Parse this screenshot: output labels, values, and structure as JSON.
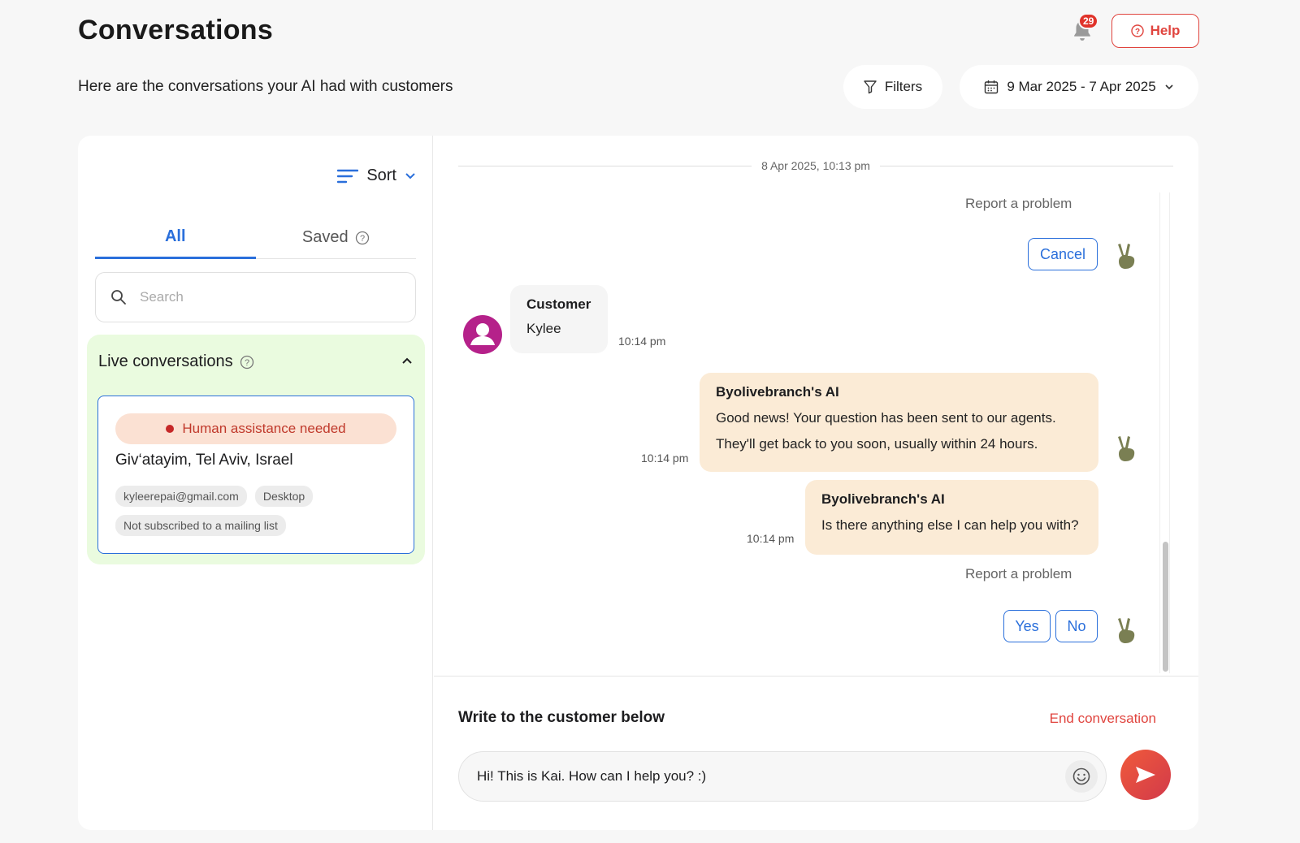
{
  "header": {
    "title": "Conversations",
    "subtitle": "Here are the conversations your AI had with customers",
    "notification_count": "29",
    "help_label": "Help",
    "filters_label": "Filters",
    "date_range": "9 Mar 2025 - 7 Apr 2025"
  },
  "sidebar": {
    "sort_label": "Sort",
    "tabs": [
      {
        "label": "All",
        "active": true
      },
      {
        "label": "Saved",
        "active": false
      }
    ],
    "search_placeholder": "Search",
    "live_section": {
      "title": "Live conversations",
      "card": {
        "alert": "Human assistance needed",
        "location": "Giv‘atayim, Tel Aviv, Israel",
        "chips": [
          "kyleerepai@gmail.com",
          "Desktop",
          "Not subscribed to a mailing list"
        ]
      }
    }
  },
  "chat": {
    "date_divider": "8 Apr 2025, 10:13 pm",
    "report_label": "Report a problem",
    "cancel_label": "Cancel",
    "customer": {
      "who": "Customer",
      "name": "Kylee",
      "time": "10:14 pm"
    },
    "ai_messages": [
      {
        "who": "Byolivebranch's AI",
        "lines": [
          "Good news! Your question has been sent to our agents.",
          "They'll get back to you soon, usually within 24 hours."
        ],
        "time": "10:14 pm"
      },
      {
        "who": "Byolivebranch's AI",
        "lines": [
          "Is there anything else I can help you with?"
        ],
        "time": "10:14 pm"
      }
    ],
    "yes_label": "Yes",
    "no_label": "No",
    "composer": {
      "label": "Write to the customer below",
      "end_label": "End conversation",
      "input_value": "Hi! This is Kai. How can I help you? :)"
    }
  },
  "colors": {
    "accent_blue": "#2a6fdb",
    "accent_red": "#e0443e",
    "live_bg": "#eafbdf",
    "ai_bubble": "#fbebd6",
    "avatar": "#b5218a",
    "hand": "#7a7f53"
  }
}
